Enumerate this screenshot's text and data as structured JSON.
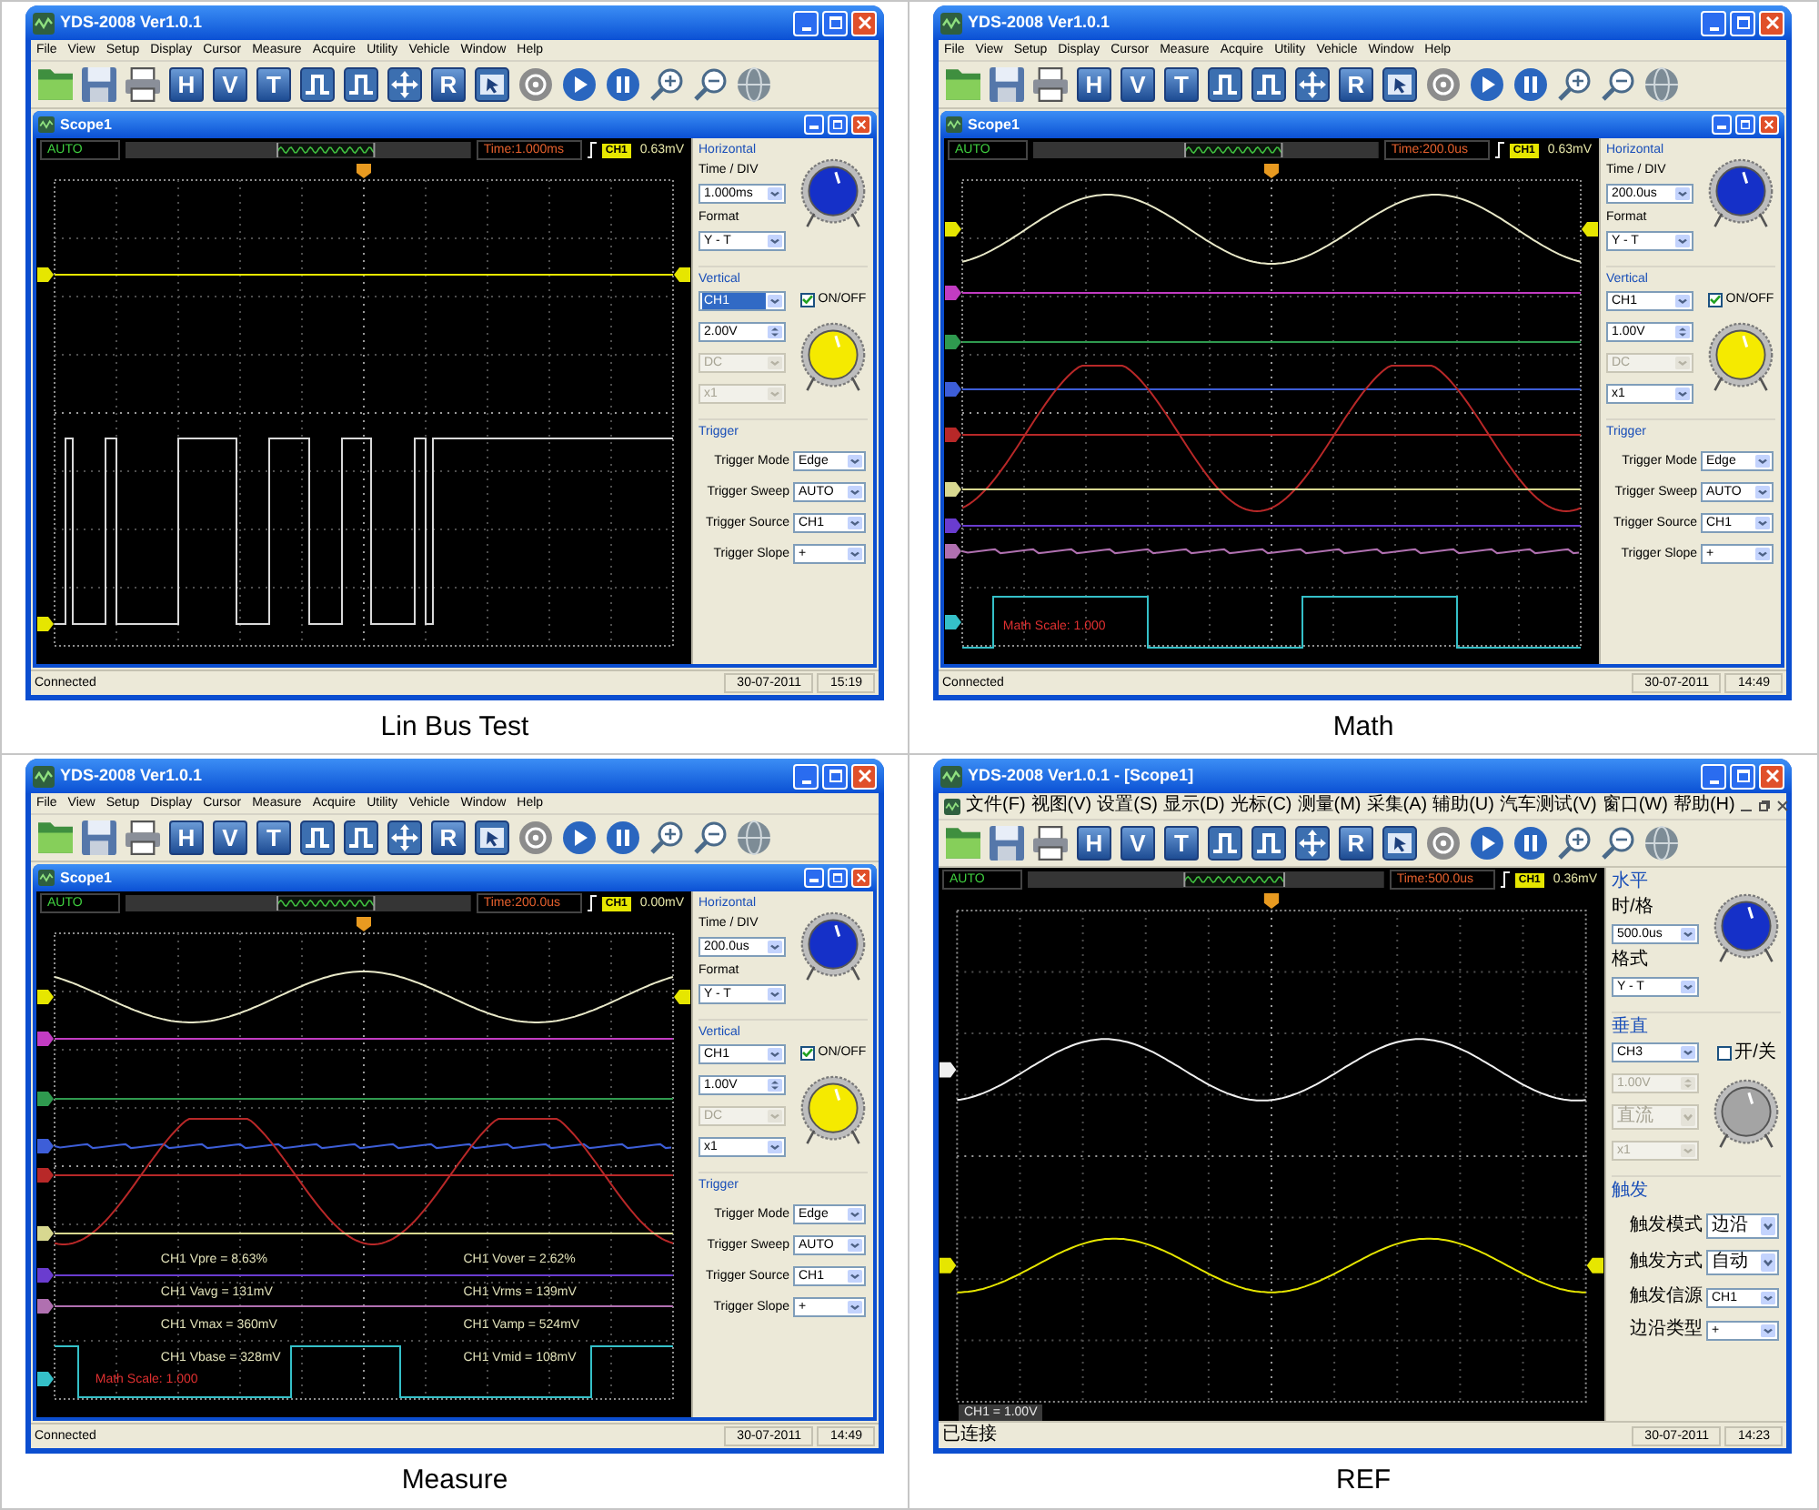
{
  "panels": [
    {
      "caption": "Lin Bus Test",
      "window": {
        "title": "YDS-2008 Ver1.0.1"
      },
      "menu": [
        "File",
        "View",
        "Setup",
        "Display",
        "Cursor",
        "Measure",
        "Acquire",
        "Utility",
        "Vehicle",
        "Window",
        "Help"
      ],
      "toolbar": [
        {
          "kind": "open"
        },
        {
          "kind": "save"
        },
        {
          "kind": "print"
        },
        {
          "kind": "letter",
          "label": "H"
        },
        {
          "kind": "letter",
          "label": "V"
        },
        {
          "kind": "letter",
          "label": "T"
        },
        {
          "kind": "pulse"
        },
        {
          "kind": "pulse"
        },
        {
          "kind": "arrows"
        },
        {
          "kind": "letter",
          "label": "R"
        },
        {
          "kind": "cursor"
        },
        {
          "kind": "record"
        },
        {
          "kind": "play"
        },
        {
          "kind": "pause"
        },
        {
          "kind": "zoom_in"
        },
        {
          "kind": "zoom_out"
        },
        {
          "kind": "globe"
        }
      ],
      "child_window": {
        "title": "Scope1"
      },
      "scope_header": {
        "mode": "AUTO",
        "time": "Time:1.000ms",
        "channel": "CH1",
        "reading": "0.63mV"
      },
      "display": {
        "kind": "lin_bus",
        "markers": [
          {
            "color": "#e6e600"
          },
          {
            "color": "#e6e600"
          }
        ]
      },
      "controls": {
        "horizontal": {
          "title": "Horizontal",
          "time_div_label": "Time / DIV",
          "time_div": "1.000ms",
          "format_label": "Format",
          "format": "Y - T"
        },
        "vertical": {
          "title": "Vertical",
          "channel": {
            "value": "CH1",
            "focused": true
          },
          "toggle": {
            "label": "ON/OFF",
            "checked": true
          },
          "volts": {
            "value": "2.00V",
            "disabled": false
          },
          "coupling": {
            "value": "DC",
            "disabled": true
          },
          "probe": {
            "value": "x1",
            "disabled": true
          }
        },
        "trigger": {
          "title": "Trigger",
          "rows": [
            {
              "label": "Trigger Mode",
              "value": "Edge"
            },
            {
              "label": "Trigger Sweep",
              "value": "AUTO"
            },
            {
              "label": "Trigger Source",
              "value": "CH1"
            },
            {
              "label": "Trigger Slope",
              "value": "+"
            }
          ]
        }
      },
      "status_bar": {
        "connection": "Connected",
        "date": "30-07-2011",
        "time": "15:19"
      }
    },
    {
      "caption": "Math",
      "window": {
        "title": "YDS-2008 Ver1.0.1"
      },
      "menu": [
        "File",
        "View",
        "Setup",
        "Display",
        "Cursor",
        "Measure",
        "Acquire",
        "Utility",
        "Vehicle",
        "Window",
        "Help"
      ],
      "toolbar": [
        {
          "kind": "open"
        },
        {
          "kind": "save"
        },
        {
          "kind": "print"
        },
        {
          "kind": "letter",
          "label": "H"
        },
        {
          "kind": "letter",
          "label": "V"
        },
        {
          "kind": "letter",
          "label": "T"
        },
        {
          "kind": "pulse"
        },
        {
          "kind": "pulse"
        },
        {
          "kind": "arrows"
        },
        {
          "kind": "letter",
          "label": "R"
        },
        {
          "kind": "cursor"
        },
        {
          "kind": "record"
        },
        {
          "kind": "play"
        },
        {
          "kind": "pause"
        },
        {
          "kind": "zoom_in"
        },
        {
          "kind": "zoom_out"
        },
        {
          "kind": "globe"
        }
      ],
      "child_window": {
        "title": "Scope1"
      },
      "scope_header": {
        "mode": "AUTO",
        "time": "Time:200.0us",
        "channel": "CH1",
        "reading": "0.63mV"
      },
      "display": {
        "kind": "math",
        "markers": [
          {
            "color": "#e6e600"
          },
          {
            "color": "#c23cc2"
          },
          {
            "color": "#2f9a4f"
          },
          {
            "color": "#3d5ed8"
          },
          {
            "color": "#b82828"
          },
          {
            "color": "#d8d890"
          },
          {
            "color": "#6a3ccf"
          },
          {
            "color": "#b070b0"
          },
          {
            "color": "#35c0c8"
          }
        ],
        "math_label": "Math Scale: 1.000"
      },
      "controls": {
        "horizontal": {
          "title": "Horizontal",
          "time_div_label": "Time / DIV",
          "time_div": "200.0us",
          "format_label": "Format",
          "format": "Y - T"
        },
        "vertical": {
          "title": "Vertical",
          "channel": {
            "value": "CH1",
            "focused": false
          },
          "toggle": {
            "label": "ON/OFF",
            "checked": true
          },
          "volts": {
            "value": "1.00V",
            "disabled": false
          },
          "coupling": {
            "value": "DC",
            "disabled": true
          },
          "probe": {
            "value": "x1",
            "disabled": false
          }
        },
        "trigger": {
          "title": "Trigger",
          "rows": [
            {
              "label": "Trigger Mode",
              "value": "Edge"
            },
            {
              "label": "Trigger Sweep",
              "value": "AUTO"
            },
            {
              "label": "Trigger Source",
              "value": "CH1"
            },
            {
              "label": "Trigger Slope",
              "value": "+"
            }
          ]
        }
      },
      "status_bar": {
        "connection": "Connected",
        "date": "30-07-2011",
        "time": "14:49"
      }
    },
    {
      "caption": "Measure",
      "window": {
        "title": "YDS-2008 Ver1.0.1"
      },
      "menu": [
        "File",
        "View",
        "Setup",
        "Display",
        "Cursor",
        "Measure",
        "Acquire",
        "Utility",
        "Vehicle",
        "Window",
        "Help"
      ],
      "toolbar": [
        {
          "kind": "open"
        },
        {
          "kind": "save"
        },
        {
          "kind": "print"
        },
        {
          "kind": "letter",
          "label": "H"
        },
        {
          "kind": "letter",
          "label": "V"
        },
        {
          "kind": "letter",
          "label": "T"
        },
        {
          "kind": "pulse"
        },
        {
          "kind": "pulse"
        },
        {
          "kind": "arrows"
        },
        {
          "kind": "letter",
          "label": "R"
        },
        {
          "kind": "cursor"
        },
        {
          "kind": "record"
        },
        {
          "kind": "play"
        },
        {
          "kind": "pause"
        },
        {
          "kind": "zoom_in"
        },
        {
          "kind": "zoom_out"
        },
        {
          "kind": "globe"
        }
      ],
      "child_window": {
        "title": "Scope1"
      },
      "scope_header": {
        "mode": "AUTO",
        "time": "Time:200.0us",
        "channel": "CH1",
        "reading": "0.00mV"
      },
      "display": {
        "kind": "measure",
        "markers": [
          {
            "color": "#e6e600"
          },
          {
            "color": "#c23cc2"
          },
          {
            "color": "#2f9a4f"
          },
          {
            "color": "#3d5ed8"
          },
          {
            "color": "#b82828"
          },
          {
            "color": "#d8d890"
          },
          {
            "color": "#6a3ccf"
          },
          {
            "color": "#b070b0"
          },
          {
            "color": "#35c0c8"
          }
        ],
        "measurements": [
          "CH1 Vpre = 8.63%",
          "CH1 Vover = 2.62%",
          "CH1 Vavg = 131mV",
          "CH1 Vrms = 139mV",
          "CH1 Vmax = 360mV",
          "CH1 Vamp = 524mV",
          "CH1 Vbase = 328mV",
          "CH1 Vmid = 108mV"
        ],
        "math_label": "Math Scale: 1.000"
      },
      "controls": {
        "horizontal": {
          "title": "Horizontal",
          "time_div_label": "Time / DIV",
          "time_div": "200.0us",
          "format_label": "Format",
          "format": "Y - T"
        },
        "vertical": {
          "title": "Vertical",
          "channel": {
            "value": "CH1",
            "focused": false
          },
          "toggle": {
            "label": "ON/OFF",
            "checked": true
          },
          "volts": {
            "value": "1.00V",
            "disabled": false
          },
          "coupling": {
            "value": "DC",
            "disabled": true
          },
          "probe": {
            "value": "x1",
            "disabled": false
          }
        },
        "trigger": {
          "title": "Trigger",
          "rows": [
            {
              "label": "Trigger Mode",
              "value": "Edge"
            },
            {
              "label": "Trigger Sweep",
              "value": "AUTO"
            },
            {
              "label": "Trigger Source",
              "value": "CH1"
            },
            {
              "label": "Trigger Slope",
              "value": "+"
            }
          ]
        }
      },
      "status_bar": {
        "connection": "Connected",
        "date": "30-07-2011",
        "time": "14:49"
      }
    },
    {
      "caption": "REF",
      "window": {
        "title": "YDS-2008 Ver1.0.1 - [Scope1]"
      },
      "menu": [
        "文件(F)",
        "视图(V)",
        "设置(S)",
        "显示(D)",
        "光标(C)",
        "测量(M)",
        "采集(A)",
        "辅助(U)",
        "汽车测试(V)",
        "窗口(W)",
        "帮助(H)"
      ],
      "toolbar": [
        {
          "kind": "open"
        },
        {
          "kind": "save"
        },
        {
          "kind": "print"
        },
        {
          "kind": "letter",
          "label": "H"
        },
        {
          "kind": "letter",
          "label": "V"
        },
        {
          "kind": "letter",
          "label": "T"
        },
        {
          "kind": "pulse"
        },
        {
          "kind": "pulse"
        },
        {
          "kind": "arrows"
        },
        {
          "kind": "letter",
          "label": "R"
        },
        {
          "kind": "cursor"
        },
        {
          "kind": "record"
        },
        {
          "kind": "play"
        },
        {
          "kind": "pause"
        },
        {
          "kind": "zoom_in"
        },
        {
          "kind": "zoom_out"
        },
        {
          "kind": "globe"
        }
      ],
      "scope_header": {
        "mode": "AUTO",
        "time": "Time:500.0us",
        "channel": "CH1",
        "reading": "0.36mV"
      },
      "display": {
        "kind": "ref",
        "markers": [
          {
            "color": "#f0f0f0"
          },
          {
            "color": "#e6e600"
          }
        ],
        "scale_label": "CH1 = 1.00V"
      },
      "controls": {
        "horizontal": {
          "title": "水平",
          "time_div_label": "时/格",
          "time_div": "500.0us",
          "format_label": "格式",
          "format": "Y - T"
        },
        "vertical": {
          "title": "垂直",
          "channel": {
            "value": "CH3",
            "focused": false
          },
          "toggle": {
            "label": "开/关",
            "checked": false
          },
          "volts": {
            "value": "1.00V",
            "disabled": true
          },
          "coupling": {
            "value": "直流",
            "disabled": true
          },
          "probe": {
            "value": "x1",
            "disabled": true
          }
        },
        "trigger": {
          "title": "触发",
          "rows": [
            {
              "label": "触发模式",
              "value": "边沿"
            },
            {
              "label": "触发方式",
              "value": "自动"
            },
            {
              "label": "触发信源",
              "value": "CH1"
            },
            {
              "label": "边沿类型",
              "value": "+"
            }
          ]
        }
      },
      "status_bar": {
        "connection": "已连接",
        "date": "30-07-2011",
        "time": "14:23"
      }
    }
  ]
}
